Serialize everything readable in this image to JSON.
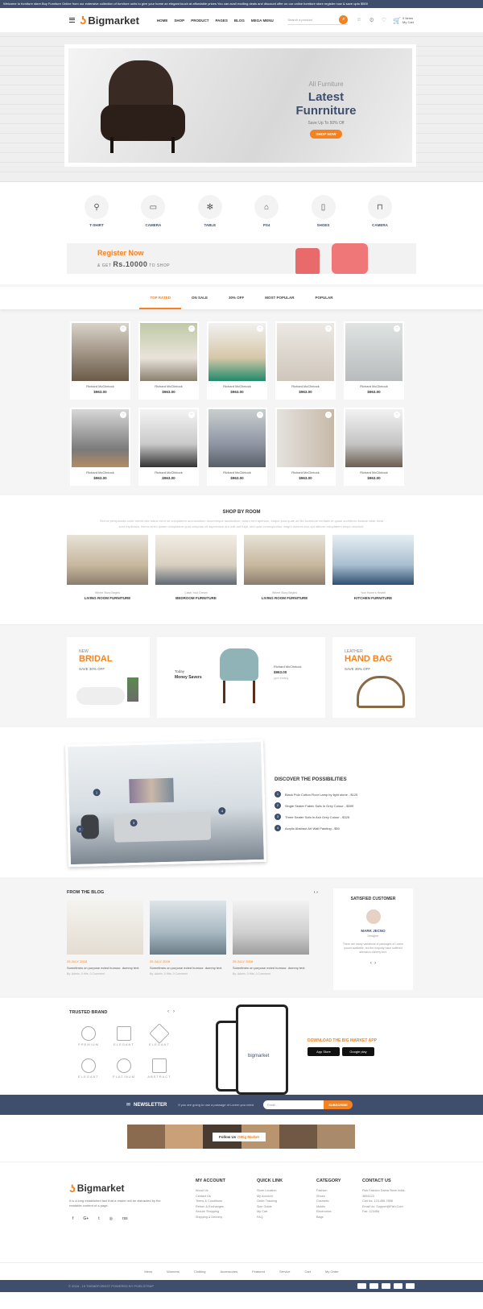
{
  "topbar": {
    "text": "Welcome to furniture store.Buy Furniture Online from our extensive collection of furniture units to give your home an elegant touch at affordable prices.You can avail exciting deals and discount offer on our online furniture store register now & save upto $500"
  },
  "header": {
    "logo": "Bigmarket",
    "nav": [
      "HOME",
      "SHOP",
      "PRODUCT",
      "PAGES",
      "BLOG",
      "MEGA MENU"
    ],
    "search_placeholder": "Search a product",
    "cart_items": "0 Items",
    "cart_label": "My Cart"
  },
  "hero": {
    "small": "All Furniture",
    "title": "Latest Funrniture",
    "subtitle": "Save Up To 50% Off",
    "button": "SHOP NOW"
  },
  "categories": [
    "T-SHIRT",
    "CAMERA",
    "TABLE",
    "PS4",
    "SHOES",
    "CAMERA"
  ],
  "register": {
    "title": "Register Now",
    "prefix": "& GET",
    "amount": "Rs.10000",
    "suffix": "TO SHOP"
  },
  "tabs": [
    "TOP RATED",
    "ON SALE",
    "30% OFF",
    "MOST POPULAR",
    "POPULAR"
  ],
  "products": [
    {
      "name": "Richard McClintock",
      "price": "$963.00"
    },
    {
      "name": "Richard McClintock",
      "price": "$963.00"
    },
    {
      "name": "Richard McClintock",
      "price": "$963.00"
    },
    {
      "name": "Richard McClintock",
      "price": "$963.00"
    },
    {
      "name": "Richard McClintock",
      "price": "$963.00"
    },
    {
      "name": "Richard McClintock",
      "price": "$963.00"
    },
    {
      "name": "Richard McClintock",
      "price": "$963.00"
    },
    {
      "name": "Richard McClintock",
      "price": "$963.00"
    },
    {
      "name": "Richard McClintock",
      "price": "$963.00"
    },
    {
      "name": "Richard McClintock",
      "price": "$963.00"
    }
  ],
  "shop_by_room": {
    "title": "SHOP BY ROOM",
    "desc": "Sed ut perspiciatis unde omnis iste natus error sit voluptatem accusantium doloremque laudantium, totam rem aperiam, eaque ipsa quae ab illo inventore veritatis et quasi architecto beatae vitae dicta sunt explicabo. Nemo enim ipsam voluptatem quia voluptas sit aspernatur aut odit aut fugit, sed quia consequuntur magni dolores eos qui ratione voluptatem sequi nesciunt.",
    "rooms": [
      {
        "sub": "Where Story Begins",
        "name": "LIVING ROOM FURNITURE"
      },
      {
        "sub": "Catch Your Dream",
        "name": "BEDROOM FURNITURE"
      },
      {
        "sub": "Where Story Begins",
        "name": "LIVING ROOM FURNITURE"
      },
      {
        "sub": "Your Home's Hearth",
        "name": "KITCHEN FURNITURE"
      }
    ]
  },
  "promos": {
    "left": {
      "l1": "NEW",
      "l2": "BRIDAL",
      "l3": "SAVE 30% OFF"
    },
    "middle": {
      "l1": "Today",
      "l2": "Money Savers",
      "name": "Richard McClintock",
      "price": "$963.00",
      "note": "ppm ending"
    },
    "right": {
      "l1": "LEATHER",
      "l2": "HAND BAG",
      "l3": "SAVE 30% OFF"
    }
  },
  "discover": {
    "title": "DISCOVER THE POSSIBILITIES",
    "items": [
      "Black Polo Cotton Floor Lamp by light stone - $120",
      "Single Seater Fabric Sofa In Grey Colour - $599",
      "Three Seater Sofa In Ash Grey Colour - $325",
      "Acrylic Abstract Art Wall Painting - $50"
    ],
    "markers": [
      "1",
      "2",
      "3",
      "4"
    ]
  },
  "blog": {
    "title": "FROM THE BLOG",
    "posts": [
      {
        "date": "25 JULY 2018",
        "text": "Sometimes on purpose ected humour. dummy text.",
        "by": "By: Admin, 0 Hits, 0 Comment"
      },
      {
        "date": "25 JULY 2018",
        "text": "Sometimes on purpose ected humour. dummy text.",
        "by": "By: Admin, 0 Hits, 0 Comment"
      },
      {
        "date": "25 JULY 2018",
        "text": "Sometimes on purpose ected humour. dummy text.",
        "by": "By: Admin, 0 Hits, 0 Comment"
      }
    ]
  },
  "testimonial": {
    "title": "SATISFIED CUSTOMER",
    "name": "MARK JECNO",
    "role": "Designer",
    "quote": "There are many variations of passages of Lorem Ipsum available, but the majority have suffered alteration dummy text."
  },
  "brands": {
    "title": "TRUSTED BRAND",
    "items": [
      "PREMIUM",
      "ELEGANT",
      "ELEGANT",
      "ELEGANT",
      "PLATINUM",
      "ABSTRACT"
    ]
  },
  "app": {
    "title": "DOWNLOAD THE BIG MARKET APP",
    "appstore": "App Store",
    "googleplay": "Google play",
    "phone_logo": "bigmarket"
  },
  "newsletter": {
    "title": "NEWSLETTER",
    "desc": "If you are going to use a passage of Lorem you need",
    "placeholder": "Email...",
    "button": "SUBSCRIBE"
  },
  "instagram": {
    "prefix": "Follow Us",
    "handle": "@Big Market"
  },
  "footer": {
    "logo": "Bigmarket",
    "desc": "It is a long established fact that a reader will be distracted by the readable content of a page.",
    "social": [
      "f",
      "G+",
      "t",
      "◎",
      "rss"
    ],
    "columns": [
      {
        "title": "MY ACCOUNT",
        "items": [
          "About Us",
          "Contact Us",
          "Terms & Conditions",
          "Return & Exchanges",
          "Secure Shopping",
          "Shipping & Delivery"
        ]
      },
      {
        "title": "QUICK LINK",
        "items": [
          "Store Location",
          "My Account",
          "Order Tracking",
          "Size Guide",
          "My Cart",
          "FAQ"
        ]
      },
      {
        "title": "CATEGORY",
        "items": [
          "Fashion",
          "Shoes",
          "Cosmetic",
          "Mobile",
          "Electronics",
          "Bags"
        ]
      },
      {
        "title": "CONTACT US",
        "items": [
          "Fish Fashion Dama Store India-3654123",
          "Call Us: 123-456-7898",
          "Email Us: Support@Fish.Com",
          "Fax: 123456"
        ]
      }
    ],
    "bottom_links": [
      "Mens",
      "Womens",
      "Clothing",
      "Accessories",
      "Featured",
      "Service",
      "Cart",
      "My Order"
    ],
    "copyright": "© 2018 - 19 THEMEFOREST POWERED BY PIXELSTRAP"
  }
}
